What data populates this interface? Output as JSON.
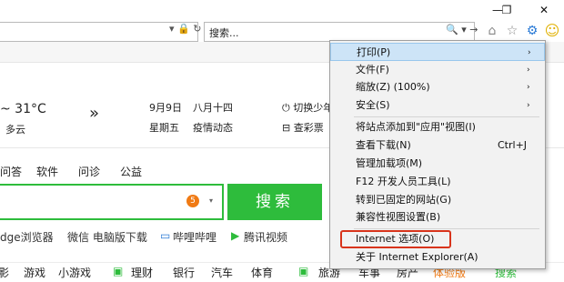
{
  "window": {
    "restore_glyph": "❐",
    "close_glyph": "✕"
  },
  "address": {
    "lock": "🔒",
    "refresh": "↻",
    "sep": "-"
  },
  "search": {
    "placeholder": "搜索...",
    "tools": "🔍 ▾ →"
  },
  "toolbar": {
    "home_icon": "⌂",
    "favorites_icon": "☆",
    "tools_icon": "⚙",
    "smiley_icon": "☺"
  },
  "weather": {
    "temp": "~ 31°C",
    "desc": "多云",
    "arrow": "»",
    "date": "9月9日",
    "lunar": "八月十四",
    "weekday": "星期五",
    "news": "疫情动态",
    "switch": "切换少年",
    "lottery": "查彩票"
  },
  "nav": {
    "tabs": [
      "问答",
      "软件",
      "问诊",
      "公益"
    ]
  },
  "searchbox": {
    "badge": "5",
    "caret": "▾",
    "button": "搜索"
  },
  "quick_links": [
    "dge浏览器",
    "微信 电脑版下载",
    "哔哩哔哩",
    "腾讯视频"
  ],
  "categories": [
    "影",
    "游戏",
    "小游戏",
    "理财",
    "银行",
    "汽车",
    "体育",
    "旅游",
    "车事",
    "房产",
    "体验版",
    "搜索"
  ],
  "menu": {
    "items": [
      {
        "label": "打印(P)",
        "arrow": "›"
      },
      {
        "label": "文件(F)",
        "arrow": "›"
      },
      {
        "label": "缩放(Z) (100%)",
        "arrow": "›"
      },
      {
        "label": "安全(S)",
        "arrow": "›"
      },
      {
        "label": "将站点添加到\"应用\"视图(I)"
      },
      {
        "label": "查看下载(N)",
        "shortcut": "Ctrl+J"
      },
      {
        "label": "管理加载项(M)"
      },
      {
        "label": "F12 开发人员工具(L)"
      },
      {
        "label": "转到已固定的网站(G)"
      },
      {
        "label": "兼容性视图设置(B)"
      },
      {
        "label": "Internet 选项(O)"
      },
      {
        "label": "关于 Internet Explorer(A)"
      }
    ]
  },
  "colors": {
    "accent_green": "#2ebc3c",
    "highlight_red": "#d8341b",
    "menu_hover": "#cde4f7"
  }
}
